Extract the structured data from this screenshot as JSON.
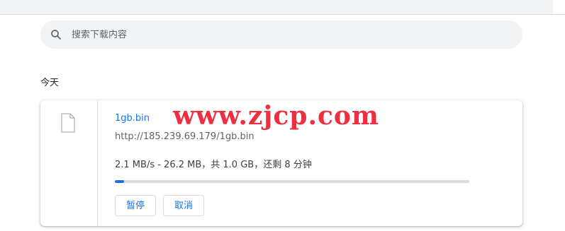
{
  "search": {
    "placeholder": "搜索下载内容",
    "icon": "search-icon"
  },
  "section": {
    "title": "今天"
  },
  "download": {
    "file_name": "1gb.bin",
    "url": "http://185.239.69.179/1gb.bin",
    "status": "2.1 MB/s - 26.2 MB，共 1.0 GB，还剩 8 分钟",
    "progress": 0.0256,
    "icon": "file-icon",
    "actions": {
      "pause_label": "暂停",
      "cancel_label": "取消"
    }
  },
  "watermark": "www.zjcp.com",
  "colors": {
    "accent": "#1a73e8",
    "watermark": "#ee2f3f",
    "search_bg": "#f1f3f4"
  }
}
